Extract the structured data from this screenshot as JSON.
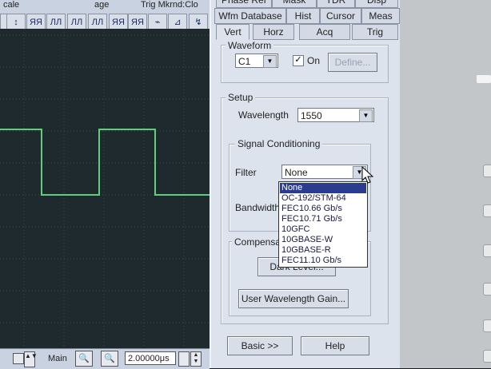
{
  "toolbar": {
    "top_labels": [
      "cale",
      "age",
      "Trig Mkrnd:Clo"
    ],
    "buttons": [
      "⊓",
      "↕",
      "ЯЯ",
      "ЛЛ",
      "ЛЛ",
      "ЛЛ",
      "ЯЯ",
      "ЯЯ",
      "⌁",
      "⊿",
      "↯",
      "↯"
    ]
  },
  "bottom": {
    "main_label": "Main",
    "timebase": "2.00000μs"
  },
  "tabs_row1": [
    "Phase Ref",
    "Mask",
    "TDR",
    "Disp"
  ],
  "tabs_row2": [
    "Wfm Database",
    "Hist",
    "Cursor",
    "Meas"
  ],
  "tabs_row3": [
    "Vert",
    "Horz",
    "Acq",
    "Trig"
  ],
  "waveform": {
    "title": "Waveform",
    "source": "C1",
    "on_label": "On",
    "on_checked": "✓",
    "define_label": "Define..."
  },
  "setup": {
    "title": "Setup",
    "wavelength_label": "Wavelength",
    "wavelength_value": "1550",
    "signal_conditioning_title": "Signal Conditioning",
    "filter_label": "Filter",
    "filter_value": "None",
    "bandwidth_label": "Bandwidth",
    "compensation_title": "Compensa",
    "dark_level_button": "Dark Level...",
    "user_wavelength_gain_button": "User Wavelength Gain..."
  },
  "filter_options": [
    "None",
    "OC-192/STM-64",
    "FEC10.66 Gb/s",
    "FEC10.71 Gb/s",
    "10GFC",
    "10GBASE-W",
    "10GBASE-R",
    "FEC11.10 Gb/s"
  ],
  "footer": {
    "basic_button": "Basic >>",
    "help_button": "Help"
  },
  "colors": {
    "trace": "#5fd07a",
    "selection": "#2b3c8f",
    "panel": "#dde3ed"
  }
}
